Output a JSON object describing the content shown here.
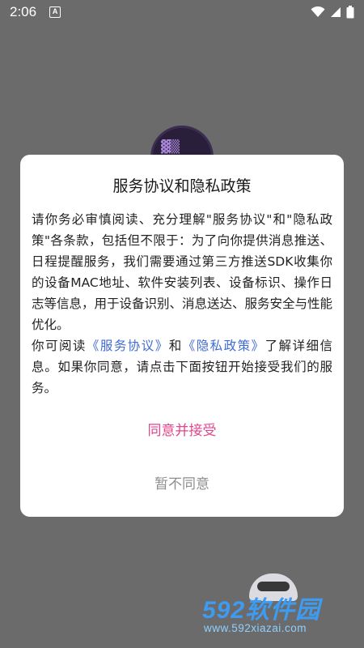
{
  "status_bar": {
    "time": "2:06",
    "notification_icon": "A"
  },
  "dialog": {
    "title": "服务协议和隐私政策",
    "para1": "请你务必审慎阅读、充分理解\"服务协议\"和\"隐私政策\"各条款，包括但不限于：为了向你提供消息推送、日程提醒服务，我们需要通过第三方推送SDK收集你的设备MAC地址、软件安装列表、设备标识、操作日志等信息，用于设备识别、消息送达、服务安全与性能优化。",
    "para2_prefix": "你可阅读",
    "link_service": "《服务协议》",
    "para2_and": "和",
    "link_privacy": "《隐私政策》",
    "para2_suffix": "了解详细信息。如果你同意，请点击下面按钮开始接受我们的服务。",
    "accept_label": "同意并接受",
    "decline_label": "暂不同意"
  },
  "watermark": {
    "title": "592软件园",
    "url": "www.592xiazai.com"
  },
  "colors": {
    "accent": "#e0468c",
    "link": "#3f6bd6",
    "decline": "#8e8e8e",
    "overlay": "#6b6b6b"
  },
  "icons": [
    "wifi-icon",
    "signal-icon",
    "battery-icon",
    "notification-a-icon"
  ]
}
